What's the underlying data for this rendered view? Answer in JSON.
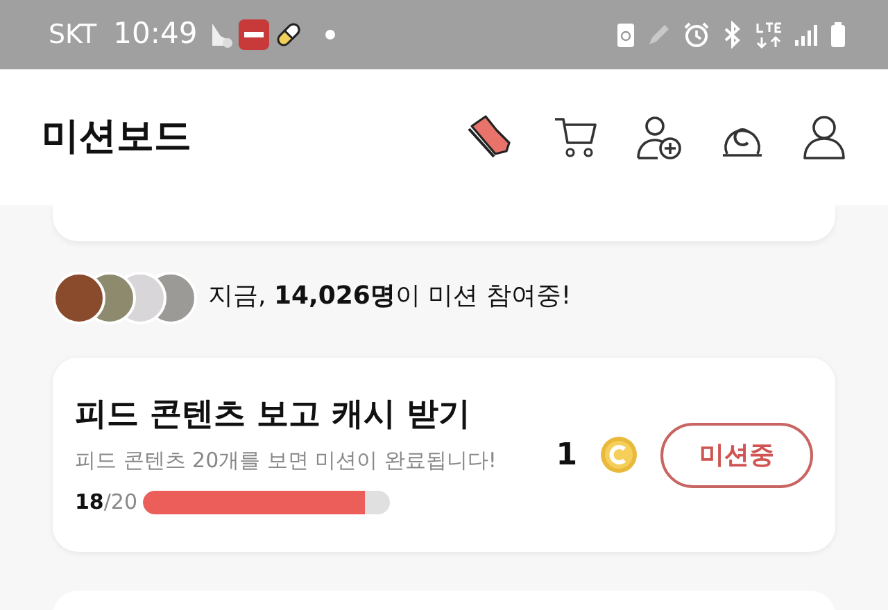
{
  "status_bar": {
    "carrier": "SKT",
    "time": "10:49"
  },
  "header": {
    "title": "미션보드"
  },
  "participants": {
    "text": "지금, **14,026명**이 미션 참여중!"
  },
  "missions": [
    {
      "title": "피드 콘텐츠 보고 캐시 받기",
      "description": "피드 콘텐츠 20개를 보면 미션이 완료됩니다!",
      "progress": "**18**/20",
      "level": 0.9,
      "reward": "1",
      "button": "미션중"
    }
  ]
}
